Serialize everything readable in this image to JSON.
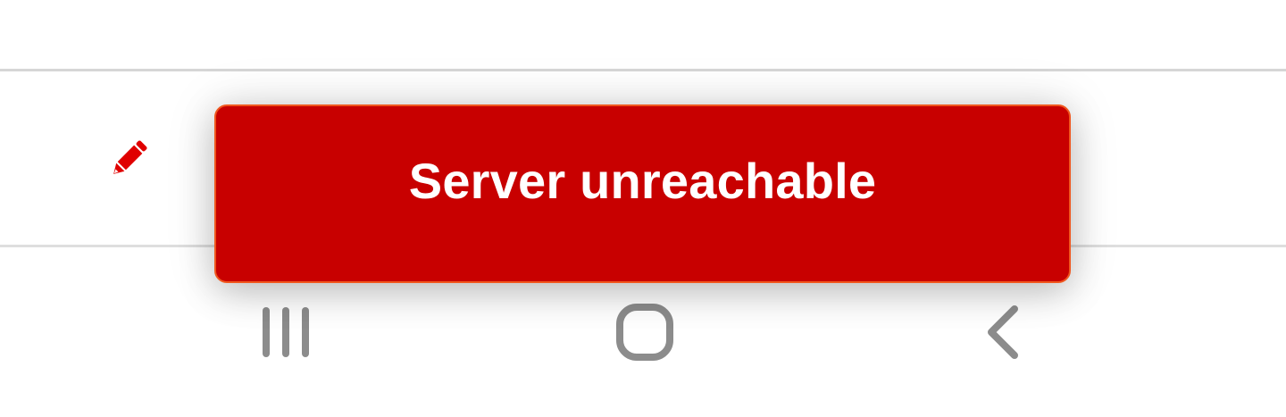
{
  "toast": {
    "message": "Server unreachable",
    "background_color": "#c80000",
    "border_color": "#f0571e",
    "text_color": "#ffffff"
  },
  "list_row": {
    "action_icon": "pencil-icon",
    "icon_color": "#e00000"
  },
  "nav_bar": {
    "buttons": [
      {
        "icon": "recent-apps-icon"
      },
      {
        "icon": "home-icon"
      },
      {
        "icon": "back-icon"
      }
    ],
    "icon_color": "#8c8c8c"
  }
}
